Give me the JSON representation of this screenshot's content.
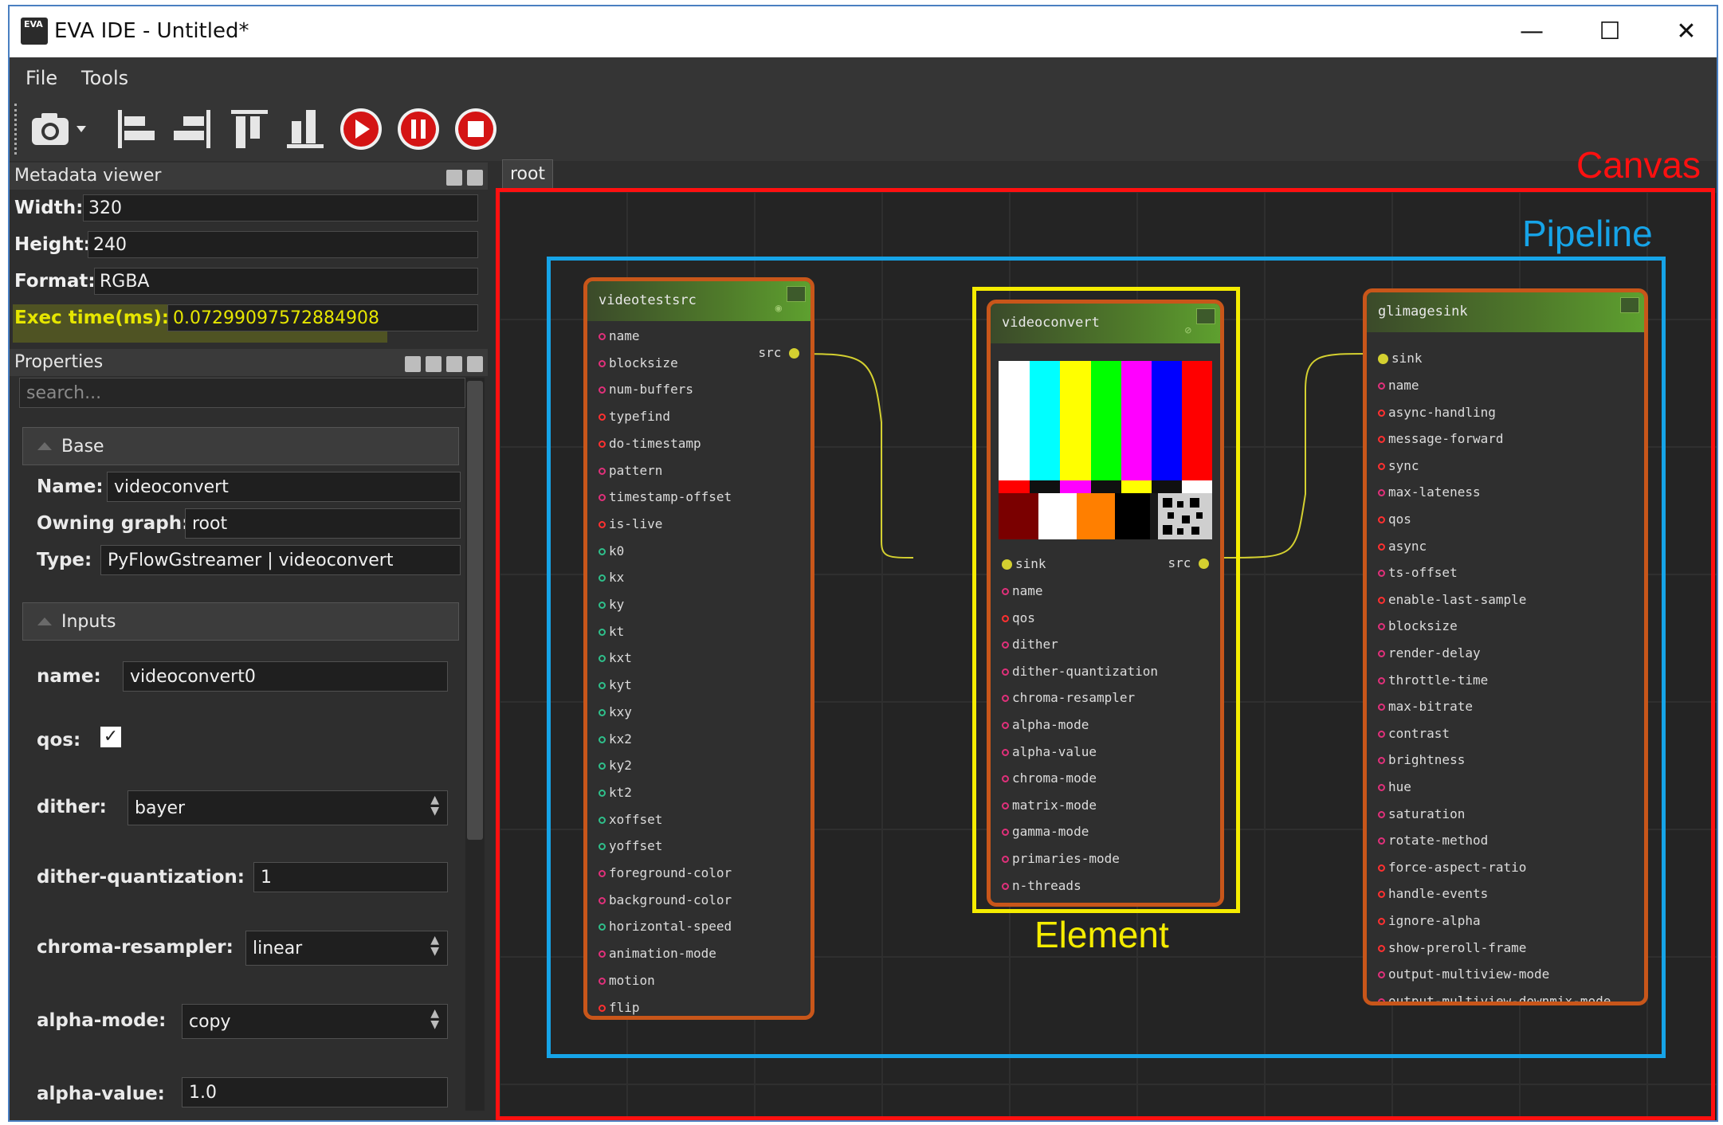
{
  "window": {
    "title": "EVA IDE - Untitled*",
    "minimize": "—",
    "maximize": "☐",
    "close": "✕"
  },
  "menu": {
    "file": "File",
    "tools": "Tools"
  },
  "toolbar": {
    "icons": [
      "camera-icon",
      "align-left-icon",
      "align-right-icon",
      "align-top-icon",
      "align-bottom-icon",
      "play-icon",
      "pause-icon",
      "stop-icon"
    ]
  },
  "metadata_viewer": {
    "title": "Metadata viewer",
    "width_label": "Width:",
    "width_value": "320",
    "height_label": "Height:",
    "height_value": "240",
    "format_label": "Format:",
    "format_value": "RGBA",
    "exec_label": "Exec time(ms):",
    "exec_value": "0.07299097572884908"
  },
  "properties": {
    "title": "Properties",
    "search_placeholder": "search...",
    "base_section": "Base",
    "name_label": "Name:",
    "name_value": "videoconvert",
    "owning_label": "Owning graph:",
    "owning_value": "root",
    "type_label": "Type:",
    "type_value": "PyFlowGstreamer | videoconvert",
    "inputs_section": "Inputs",
    "input_name_label": "name:",
    "input_name_value": "videoconvert0",
    "qos_label": "qos:",
    "qos_checked": true,
    "qos_check": "✓",
    "dither_label": "dither:",
    "dither_value": "bayer",
    "dq_label": "dither-quantization:",
    "dq_value": "1",
    "chroma_label": "chroma-resampler:",
    "chroma_value": "linear",
    "alpha_mode_label": "alpha-mode:",
    "alpha_mode_value": "copy",
    "alpha_value_label": "alpha-value:",
    "alpha_value_value": "1.0"
  },
  "canvas_tab": "root",
  "annotations": {
    "canvas": "Canvas",
    "pipeline": "Pipeline",
    "element": "Element"
  },
  "nodes": {
    "videotestsrc": {
      "title": "videotestsrc",
      "src_label": "src",
      "ports": [
        {
          "name": "name",
          "color": "pink"
        },
        {
          "name": "blocksize",
          "color": "pink"
        },
        {
          "name": "num-buffers",
          "color": "pink"
        },
        {
          "name": "typefind",
          "color": "red"
        },
        {
          "name": "do-timestamp",
          "color": "red"
        },
        {
          "name": "pattern",
          "color": "pink"
        },
        {
          "name": "timestamp-offset",
          "color": "pink"
        },
        {
          "name": "is-live",
          "color": "red"
        },
        {
          "name": "k0",
          "color": "green"
        },
        {
          "name": "kx",
          "color": "green"
        },
        {
          "name": "ky",
          "color": "green"
        },
        {
          "name": "kt",
          "color": "green"
        },
        {
          "name": "kxt",
          "color": "green"
        },
        {
          "name": "kyt",
          "color": "green"
        },
        {
          "name": "kxy",
          "color": "green"
        },
        {
          "name": "kx2",
          "color": "green"
        },
        {
          "name": "ky2",
          "color": "green"
        },
        {
          "name": "kt2",
          "color": "green"
        },
        {
          "name": "xoffset",
          "color": "green"
        },
        {
          "name": "yoffset",
          "color": "green"
        },
        {
          "name": "foreground-color",
          "color": "pink"
        },
        {
          "name": "background-color",
          "color": "pink"
        },
        {
          "name": "horizontal-speed",
          "color": "green"
        },
        {
          "name": "animation-mode",
          "color": "pink"
        },
        {
          "name": "motion",
          "color": "pink"
        },
        {
          "name": "flip",
          "color": "red"
        }
      ]
    },
    "videoconvert": {
      "title": "videoconvert",
      "sink_label": "sink",
      "src_label": "src",
      "ports": [
        {
          "name": "name",
          "color": "pink"
        },
        {
          "name": "qos",
          "color": "red"
        },
        {
          "name": "dither",
          "color": "pink"
        },
        {
          "name": "dither-quantization",
          "color": "pink"
        },
        {
          "name": "chroma-resampler",
          "color": "pink"
        },
        {
          "name": "alpha-mode",
          "color": "pink"
        },
        {
          "name": "alpha-value",
          "color": "pink"
        },
        {
          "name": "chroma-mode",
          "color": "pink"
        },
        {
          "name": "matrix-mode",
          "color": "pink"
        },
        {
          "name": "gamma-mode",
          "color": "pink"
        },
        {
          "name": "primaries-mode",
          "color": "pink"
        },
        {
          "name": "n-threads",
          "color": "pink"
        }
      ]
    },
    "glimagesink": {
      "title": "glimagesink",
      "sink_label": "sink",
      "ports": [
        {
          "name": "name",
          "color": "pink"
        },
        {
          "name": "async-handling",
          "color": "red"
        },
        {
          "name": "message-forward",
          "color": "red"
        },
        {
          "name": "sync",
          "color": "red"
        },
        {
          "name": "max-lateness",
          "color": "pink"
        },
        {
          "name": "qos",
          "color": "red"
        },
        {
          "name": "async",
          "color": "red"
        },
        {
          "name": "ts-offset",
          "color": "pink"
        },
        {
          "name": "enable-last-sample",
          "color": "red"
        },
        {
          "name": "blocksize",
          "color": "pink"
        },
        {
          "name": "render-delay",
          "color": "pink"
        },
        {
          "name": "throttle-time",
          "color": "pink"
        },
        {
          "name": "max-bitrate",
          "color": "pink"
        },
        {
          "name": "contrast",
          "color": "pink"
        },
        {
          "name": "brightness",
          "color": "pink"
        },
        {
          "name": "hue",
          "color": "pink"
        },
        {
          "name": "saturation",
          "color": "pink"
        },
        {
          "name": "rotate-method",
          "color": "pink"
        },
        {
          "name": "force-aspect-ratio",
          "color": "red"
        },
        {
          "name": "handle-events",
          "color": "red"
        },
        {
          "name": "ignore-alpha",
          "color": "red"
        },
        {
          "name": "show-preroll-frame",
          "color": "red"
        },
        {
          "name": "output-multiview-mode",
          "color": "pink"
        },
        {
          "name": "output-multiview-downmix-mode",
          "color": "pink"
        }
      ]
    }
  },
  "colors": {
    "canvas_box": "#ff1010",
    "pipeline_box": "#16a4e8",
    "element_box": "#f5ec00",
    "node_border": "#c8561a",
    "link": "#d4d030",
    "exec_highlight": "#dede00"
  }
}
